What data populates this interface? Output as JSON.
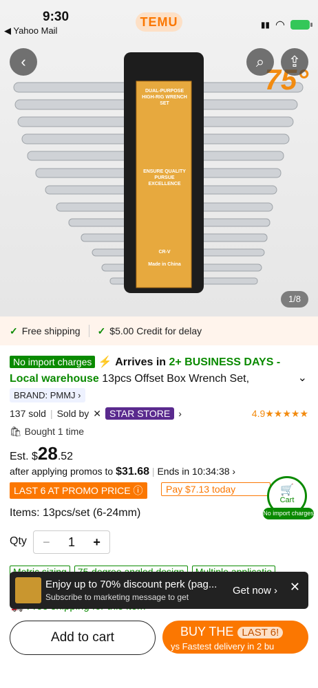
{
  "status_bar": {
    "time": "9:30",
    "back_app": "◀ Yahoo Mail",
    "app_name": "TEMU"
  },
  "hero": {
    "page_indicator": "1/8",
    "angle_label": "75°",
    "package_text": [
      "DUAL-PURPOSE",
      "HIGH-RIG WRENCH SET",
      "ENSURE QUALITY",
      "PURSUE EXCELLENCE",
      "CR-V",
      "Made in China"
    ]
  },
  "shipping_bar": {
    "free_shipping": "Free shipping",
    "credit": "$5.00 Credit for delay"
  },
  "product": {
    "no_import": "No import charges",
    "arrives": "Arrives in",
    "days": "2+ BUSINESS DAYS -",
    "warehouse": "Local warehouse",
    "title": "13pcs Offset Box Wrench Set,",
    "brand": "BRAND: PMMJ ›",
    "sold": "137 sold",
    "sold_by": "Sold by",
    "store": "STAR STORE",
    "rating": "4.9★★★★★",
    "bought": "Bought 1 time",
    "price_prefix": "Est. $",
    "price_int": "28",
    "price_dec": ".52",
    "promo_text": "after applying promos to",
    "promo_price": "$31.68",
    "ends": "Ends in 10:34:38 ›",
    "last6": "LAST 6 AT PROMO PRICE ⓘ",
    "pay_today": "Pay $7.13 today",
    "items": "Items: 13pcs/set (6-24mm)",
    "qty_label": "Qty",
    "qty_value": "1",
    "chips": [
      "Metric sizing",
      "75-degree angled design",
      "Multiple applicatio"
    ]
  },
  "floating_cart": {
    "label": "Cart",
    "import": "No import charges"
  },
  "toast": {
    "title": "Enjoy up to 70% discount perk (pag...",
    "subtitle": "Subscribe to marketing message to get",
    "action": "Get now ›"
  },
  "free_line": "Free shipping for this item",
  "bottom": {
    "add_to_cart": "Add to cart",
    "buy": "BUY THE",
    "last": "LAST 6!",
    "delivery": "ys  Fastest delivery in 2 bu"
  },
  "colors": {
    "brand": "#fb7701",
    "green": "#0a8a00",
    "store": "#5a2a8e"
  }
}
